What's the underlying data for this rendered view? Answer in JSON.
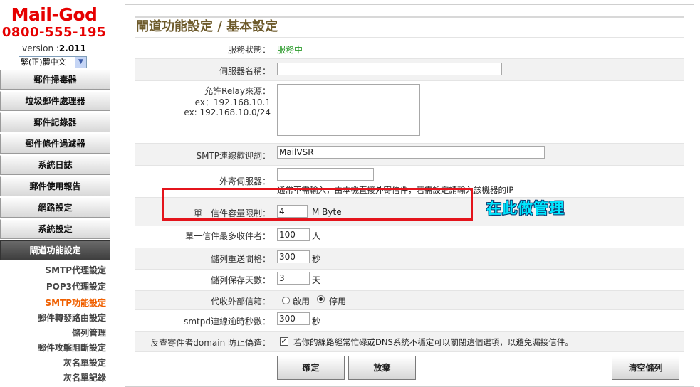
{
  "brand": {
    "name": "Mail-God",
    "phone": "0800-555-195",
    "version_label": "version :",
    "version_number": "2.011",
    "language": "繁(正)體中文"
  },
  "sidebar": {
    "menu": [
      {
        "label": "郵件掃毒器",
        "active": false
      },
      {
        "label": "垃圾郵件處理器",
        "active": false
      },
      {
        "label": "郵件記錄器",
        "active": false
      },
      {
        "label": "郵件條件過濾器",
        "active": false
      },
      {
        "label": "系統日誌",
        "active": false
      },
      {
        "label": "郵件使用報告",
        "active": false
      },
      {
        "label": "網路設定",
        "active": false
      },
      {
        "label": "系統設定",
        "active": false
      },
      {
        "label": "閘道功能設定",
        "active": true
      }
    ],
    "submenu": [
      {
        "label": "SMTP代理設定",
        "active": false
      },
      {
        "label": "POP3代理設定",
        "active": false
      },
      {
        "label": "SMTP功能設定",
        "active": true
      },
      {
        "label": "郵件轉發路由設定",
        "active": false
      },
      {
        "label": "儲列管理",
        "active": false
      },
      {
        "label": "郵件攻擊阻斷設定",
        "active": false
      },
      {
        "label": "灰名單設定",
        "active": false
      },
      {
        "label": "灰名單記錄",
        "active": false
      }
    ]
  },
  "page": {
    "title": "閘道功能設定 / 基本設定"
  },
  "form": {
    "service_status_label": "服務狀態：",
    "service_status_value": "服務中",
    "server_name_label": "伺服器名稱：",
    "server_name_value": "",
    "relay_label": "允許Relay來源：",
    "relay_ex1": "ex：192.168.10.1",
    "relay_ex2": "ex: 192.168.10.0/24",
    "relay_value": "",
    "smtp_greeting_label": "SMTP連線歡迎詞：",
    "smtp_greeting_value": "MailVSR",
    "outbound_server_label": "外寄伺服器：",
    "outbound_server_value": "",
    "outbound_server_hint": "通常不需輸入，由本機直接外寄信件，若需設定請輸入該機器的IP",
    "max_size_label": "單一信件容量限制：",
    "max_size_value": "4",
    "max_size_unit": "M Byte",
    "max_recipients_label": "單一信件最多收件者：",
    "max_recipients_value": "100",
    "max_recipients_unit": "人",
    "retry_interval_label": "儲列重送間格：",
    "retry_interval_value": "300",
    "retry_interval_unit": "秒",
    "queue_days_label": "儲列保存天數：",
    "queue_days_value": "3",
    "queue_days_unit": "天",
    "external_mailbox_label": "代收外部信箱：",
    "external_mailbox_enable": "啟用",
    "external_mailbox_disable": "停用",
    "external_mailbox_selected": "停用",
    "smtpd_timeout_label": "smtpd連線逾時秒數：",
    "smtpd_timeout_value": "300",
    "smtpd_timeout_unit": "秒",
    "antispoof_label": "反查寄件者domain 防止偽造：",
    "antispoof_checked": true,
    "antispoof_hint": "若你的線路經常忙碌或DNS系統不穩定可以關閉這個選項，以避免漏接信件。"
  },
  "buttons": {
    "confirm": "確定",
    "discard": "放棄",
    "clear_queue": "清空儲列"
  },
  "annotation": {
    "text": "在此做管理",
    "highlight_color": "#e4141c",
    "text_color": "#00e8ff"
  }
}
